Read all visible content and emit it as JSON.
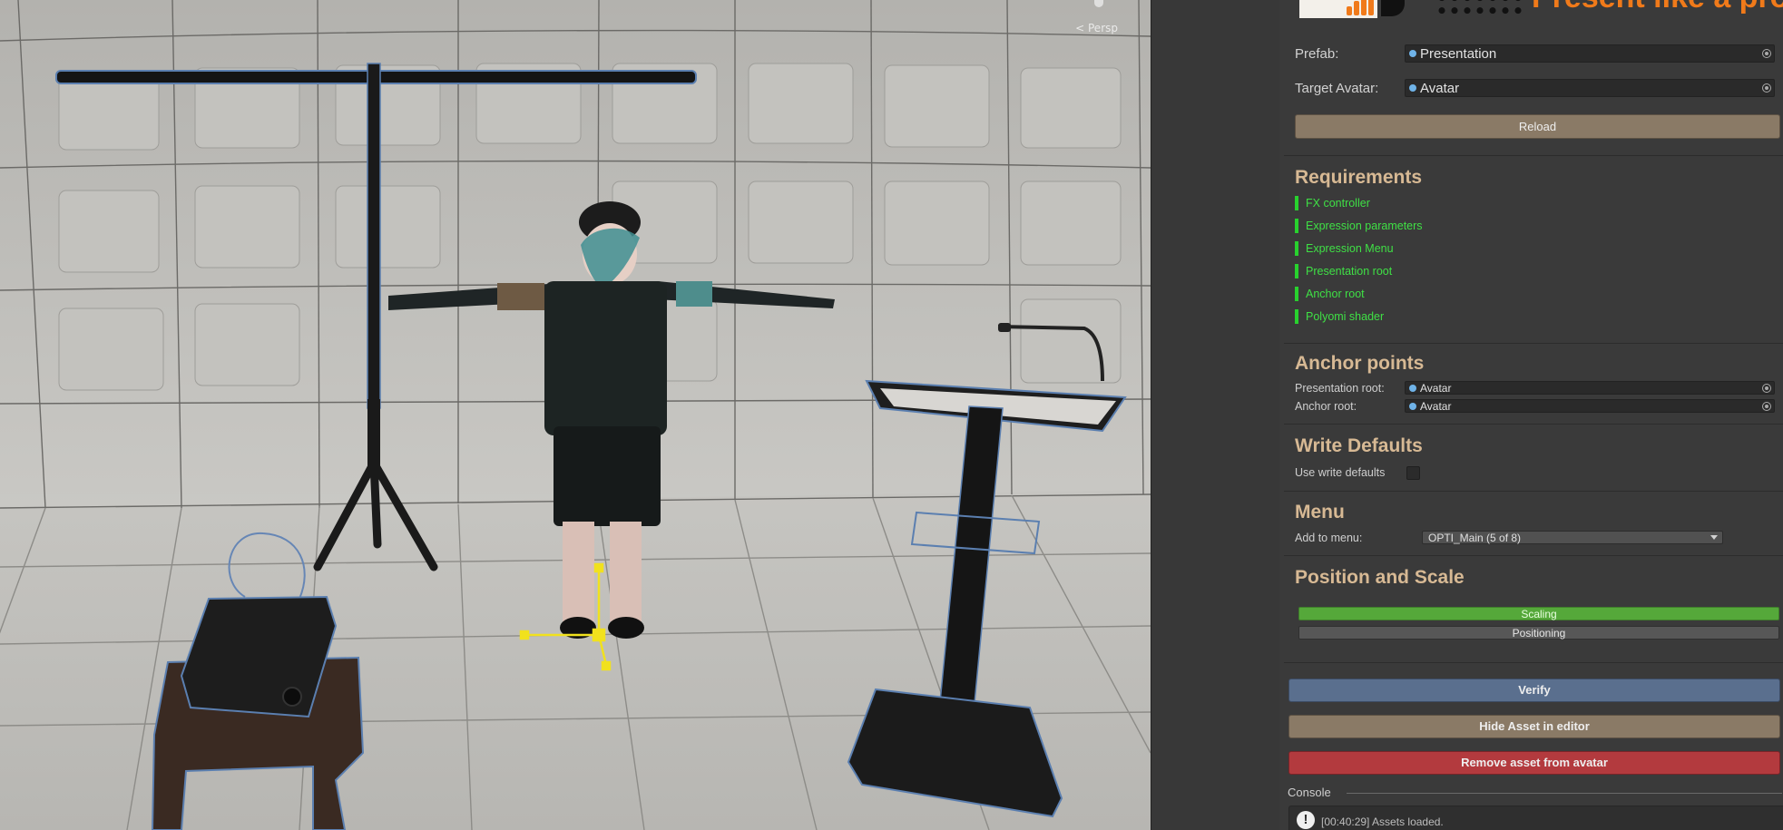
{
  "scene": {
    "camera_mode": "Persp"
  },
  "banner": {
    "title": "Present like a pro"
  },
  "inspector": {
    "prefab": {
      "label": "Prefab:",
      "value": "Presentation"
    },
    "target_avatar": {
      "label": "Target Avatar:",
      "value": "Avatar"
    },
    "reload_label": "Reload",
    "requirements": {
      "heading": "Requirements",
      "items": [
        "FX controller",
        "Expression parameters",
        "Expression Menu",
        "Presentation root",
        "Anchor root",
        "Polyomi shader"
      ],
      "ok_color": "#28d12e"
    },
    "anchor_points": {
      "heading": "Anchor points",
      "presentation_root": {
        "label": "Presentation root:",
        "value": "Avatar"
      },
      "anchor_root": {
        "label": "Anchor root:",
        "value": "Avatar"
      }
    },
    "write_defaults": {
      "heading": "Write Defaults",
      "use_label": "Use write defaults",
      "checked": false
    },
    "menu": {
      "heading": "Menu",
      "add_label": "Add to menu:",
      "selected": "OPTI_Main (5 of 8)"
    },
    "position_scale": {
      "heading": "Position and Scale",
      "scaling_label": "Scaling",
      "positioning_label": "Positioning",
      "active_color": "#55a83a"
    },
    "verify_label": "Verify",
    "hide_label": "Hide Asset in editor",
    "remove_label": "Remove asset from avatar",
    "console": {
      "label": "Console",
      "message": "[00:40:29] Assets loaded."
    }
  }
}
